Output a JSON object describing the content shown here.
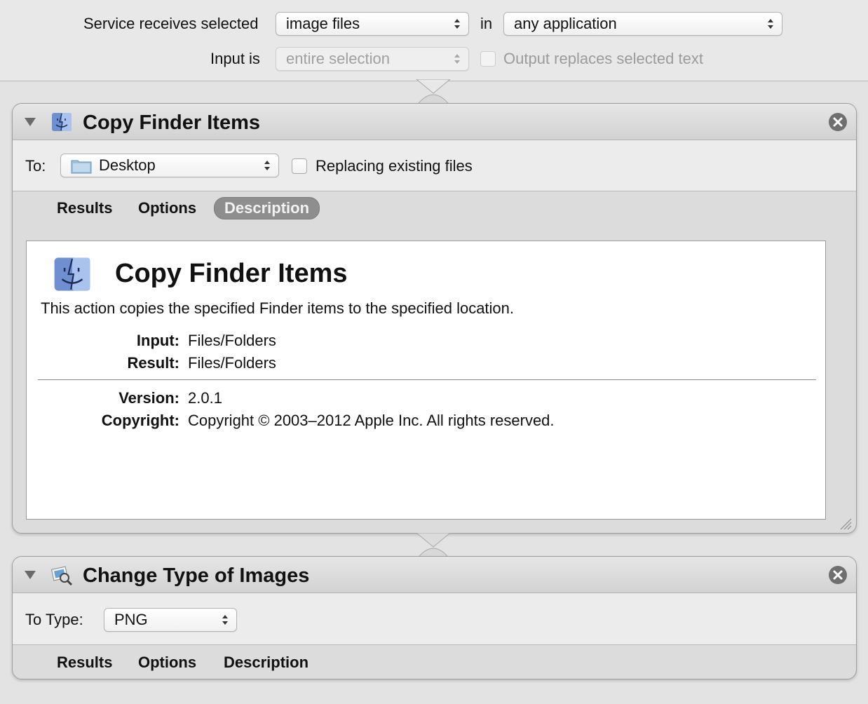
{
  "service": {
    "receives_label": "Service receives selected",
    "receives_value": "image files",
    "in_label": "in",
    "application_value": "any application",
    "input_label": "Input is",
    "input_value": "entire selection",
    "output_replaces_label": "Output replaces selected text",
    "output_replaces_checked": false
  },
  "actions": [
    {
      "title": "Copy Finder Items",
      "icon": "finder-icon",
      "to_label": "To:",
      "to_value": "Desktop",
      "replacing_label": "Replacing existing files",
      "replacing_checked": false,
      "tabs": [
        "Results",
        "Options",
        "Description"
      ],
      "selected_tab": "Description",
      "description": {
        "title": "Copy Finder Items",
        "text": "This action copies the specified Finder items to the specified location.",
        "input_key": "Input:",
        "input_val": "Files/Folders",
        "result_key": "Result:",
        "result_val": "Files/Folders",
        "version_key": "Version:",
        "version_val": "2.0.1",
        "copyright_key": "Copyright:",
        "copyright_val": "Copyright © 2003–2012 Apple Inc.  All rights reserved."
      }
    },
    {
      "title": "Change Type of Images",
      "icon": "preview-icon",
      "to_type_label": "To Type:",
      "to_type_value": "PNG",
      "tabs": [
        "Results",
        "Options",
        "Description"
      ]
    }
  ],
  "colors": {
    "background": "#e3e3e3",
    "selected_tab": "#8e8e8e",
    "close_button": "#6f6f6f"
  }
}
